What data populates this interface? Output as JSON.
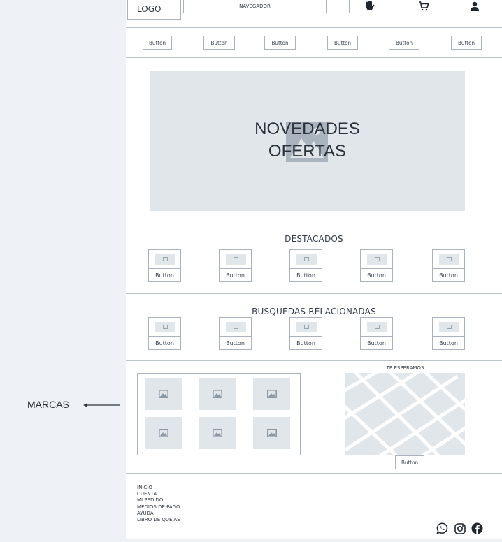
{
  "header": {
    "logo": "LOGO",
    "navegador": "NAVEGADOR"
  },
  "nav_buttons": [
    "Button",
    "Button",
    "Button",
    "Button",
    "Button",
    "Button"
  ],
  "hero": {
    "line1": "NOVEDADES",
    "line2": "OFERTAS"
  },
  "destacados": {
    "title": "DESTACADOS",
    "items": [
      "Button",
      "Button",
      "Button",
      "Button",
      "Button"
    ]
  },
  "busquedas": {
    "title": "BUSQUEDAS RELACIONADAS",
    "items": [
      "Button",
      "Button",
      "Button",
      "Button",
      "Button"
    ]
  },
  "marcas": {
    "label": "MARCAS"
  },
  "map": {
    "title": "TE ESPERAMOS",
    "button": "Button"
  },
  "footer": {
    "links": [
      "INICIO",
      "CUENTA",
      "MI PEDIDO",
      "MEDIOS DE PAGO",
      "AYUDA",
      "LIBRO DE QUEJAS"
    ]
  },
  "icons": [
    "hand-icon",
    "cart-icon",
    "user-icon",
    "whatsapp-icon",
    "instagram-icon",
    "facebook-icon"
  ],
  "colors": {
    "background": "#eef2f6",
    "placeholder": "#e1e6eb",
    "border": "#aab3bd"
  }
}
